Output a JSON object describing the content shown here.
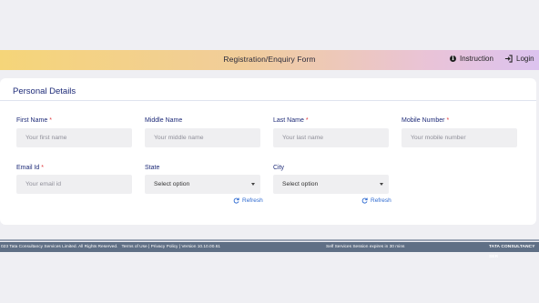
{
  "header": {
    "title": "Registration/Enquiry Form",
    "instruction_label": "Instruction",
    "login_label": "Login"
  },
  "card": {
    "title": "Personal Details"
  },
  "fields": {
    "first_name": {
      "label": "First Name",
      "required": "*",
      "placeholder": "Your first name"
    },
    "middle_name": {
      "label": "Middle Name",
      "placeholder": "Your middle name"
    },
    "last_name": {
      "label": "Last Name",
      "required": "*",
      "placeholder": "Your last name"
    },
    "mobile_number": {
      "label": "Mobile Number",
      "required": "*",
      "placeholder": "Your mobile number"
    },
    "email_id": {
      "label": "Email Id",
      "required": "*",
      "placeholder": "Your email id"
    },
    "state": {
      "label": "State",
      "value": "Select option",
      "refresh_label": "Refresh"
    },
    "city": {
      "label": "City",
      "value": "Select option",
      "refresh_label": "Refresh"
    }
  },
  "footer": {
    "copyright": "023 Tata Consultancy Services Limited. All Rights Reserved.",
    "links": "Terms of Use | Privacy Policy | Version 10.10.00.61",
    "session": "Self Services Session expires in 30 mins",
    "brand": "TATA CONSULTANCY SER"
  },
  "colors": {
    "label": "#1e2b78",
    "required": "#e0373b",
    "refresh": "#2f6bd1",
    "footer_bg": "#5f6f85"
  }
}
